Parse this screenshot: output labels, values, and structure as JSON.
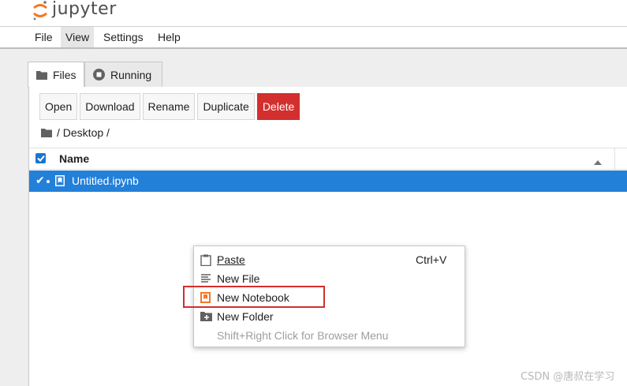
{
  "app": {
    "logo_text": "jupyter"
  },
  "menubar": [
    {
      "label": "File"
    },
    {
      "label": "View"
    },
    {
      "label": "Settings"
    },
    {
      "label": "Help"
    }
  ],
  "tabs": [
    {
      "label": "Files",
      "icon": "folder-icon",
      "active": true
    },
    {
      "label": "Running",
      "icon": "stop-circle-icon",
      "active": false
    }
  ],
  "toolbar": [
    {
      "label": "Open"
    },
    {
      "label": "Download"
    },
    {
      "label": "Rename"
    },
    {
      "label": "Duplicate"
    },
    {
      "label": "Delete",
      "style": "danger"
    }
  ],
  "breadcrumb": {
    "path": "/ Desktop /"
  },
  "file_list": {
    "header": {
      "name": "Name"
    },
    "rows": [
      {
        "name": "Untitled.ipynb",
        "selected": true,
        "icon": "notebook-icon"
      }
    ]
  },
  "context_menu": {
    "items": [
      {
        "label": "Paste",
        "shortcut": "Ctrl+V",
        "icon": "clipboard-icon"
      },
      {
        "label": "New File",
        "icon": "text-file-icon"
      },
      {
        "label": "New Notebook",
        "icon": "notebook-icon"
      },
      {
        "label": "New Folder",
        "icon": "new-folder-icon"
      },
      {
        "label": "Shift+Right Click for Browser Menu",
        "disabled": true
      }
    ]
  },
  "watermark": "CSDN @唐叔在学习",
  "colors": {
    "accent": "#2280d9",
    "danger": "#d32f2f",
    "notebook": "#f37726"
  }
}
